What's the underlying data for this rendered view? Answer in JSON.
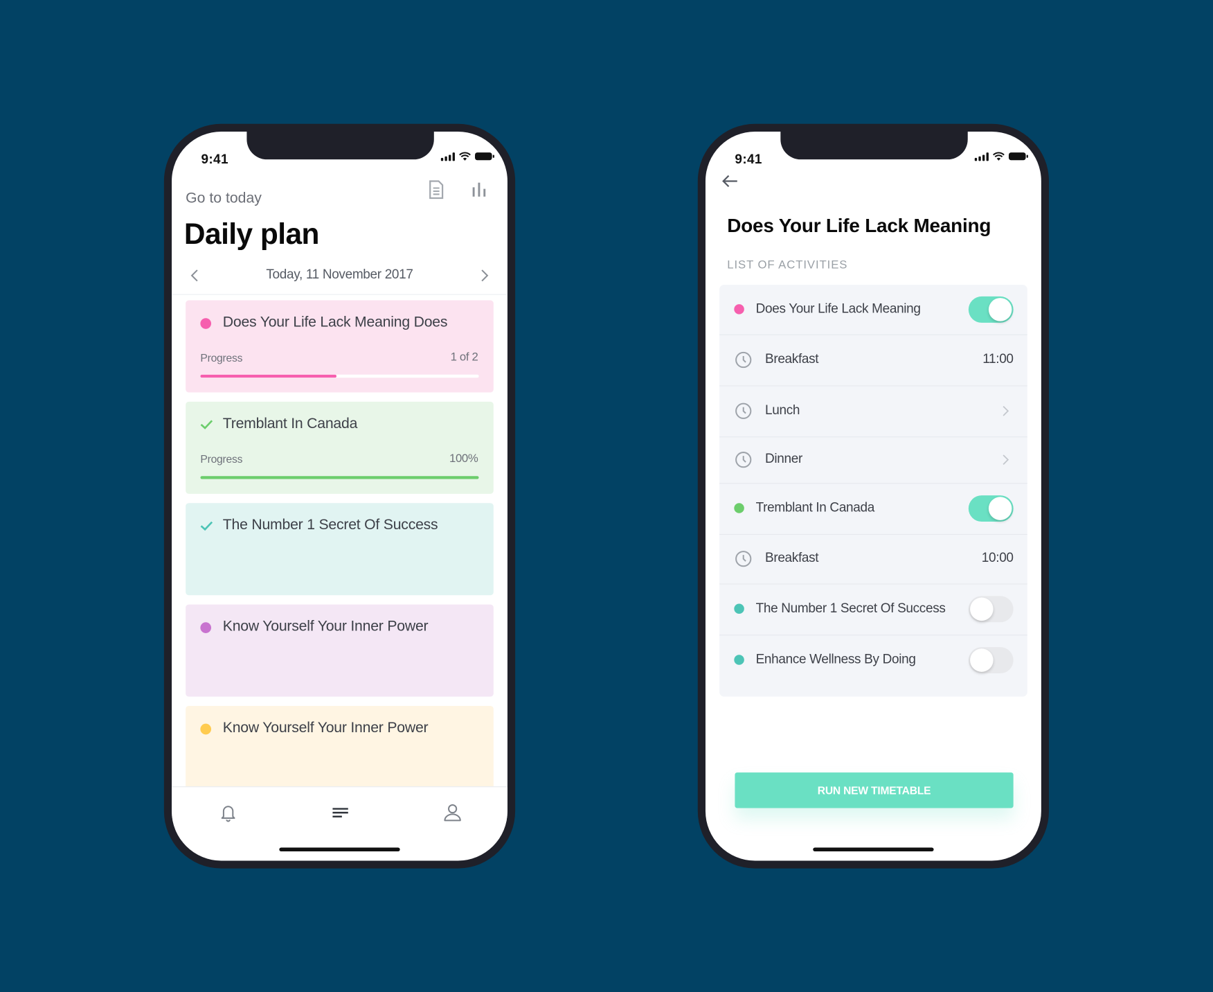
{
  "colors": {
    "background": "#024264",
    "accent": "#6ae0c3",
    "pink": "#f65fae",
    "green": "#6ccd6c",
    "teal": "#4cc4b6",
    "purple": "#c873cf",
    "yellow": "#ffcb4f"
  },
  "status_bar": {
    "time": "9:41"
  },
  "daily_plan": {
    "go_to_today": "Go to today",
    "title": "Daily plan",
    "date": "Today, 11 November 2017",
    "icons": [
      "document-icon",
      "bar-chart-icon",
      "chevron-left-icon",
      "chevron-right-icon"
    ],
    "cards": [
      {
        "name": "Does Your Life Lack Meaning Does",
        "marker": "dot",
        "color": "#f65fae",
        "bg": "#fce3f0",
        "progress_label": "Progress",
        "progress_text": "1 of 2",
        "progress": 0.49
      },
      {
        "name": "Tremblant In Canada",
        "marker": "check",
        "color": "#6ccd6c",
        "bg": "#e8f6e8",
        "progress_label": "Progress",
        "progress_text": "100%",
        "progress": 1.0
      },
      {
        "name": "The Number 1 Secret Of Success",
        "marker": "check",
        "color": "#4cc4b6",
        "bg": "#e1f4f2"
      },
      {
        "name": "Know Yourself Your Inner Power",
        "marker": "dot",
        "color": "#c873cf",
        "bg": "#f4e7f5"
      },
      {
        "name": "Know Yourself Your Inner Power",
        "marker": "dot",
        "color": "#ffcb4f",
        "bg": "#fff5e3"
      }
    ],
    "tabbar": [
      "bell-icon",
      "list-icon",
      "user-icon"
    ]
  },
  "detail": {
    "title": "Does Your Life Lack Meaning",
    "section_label": "LIST OF ACTIVITIES",
    "rows": [
      {
        "type": "activity",
        "label": "Does Your Life Lack Meaning",
        "color": "#f65fae",
        "enabled": true
      },
      {
        "type": "meal",
        "label": "Breakfast",
        "value": "11:00"
      },
      {
        "type": "meal",
        "label": "Lunch",
        "chevron": true
      },
      {
        "type": "meal",
        "label": "Dinner",
        "chevron": true
      },
      {
        "type": "activity",
        "label": "Tremblant In Canada",
        "color": "#6ccd6c",
        "enabled": true
      },
      {
        "type": "meal",
        "label": "Breakfast",
        "value": "10:00"
      },
      {
        "type": "activity",
        "label": "The Number 1 Secret Of Success",
        "color": "#4cc4b6",
        "enabled": false
      },
      {
        "type": "activity",
        "label": "Enhance Wellness By Doing",
        "color": "#4cc4b6",
        "enabled": false
      }
    ],
    "run_button": "RUN NEW TIMETABLE"
  }
}
